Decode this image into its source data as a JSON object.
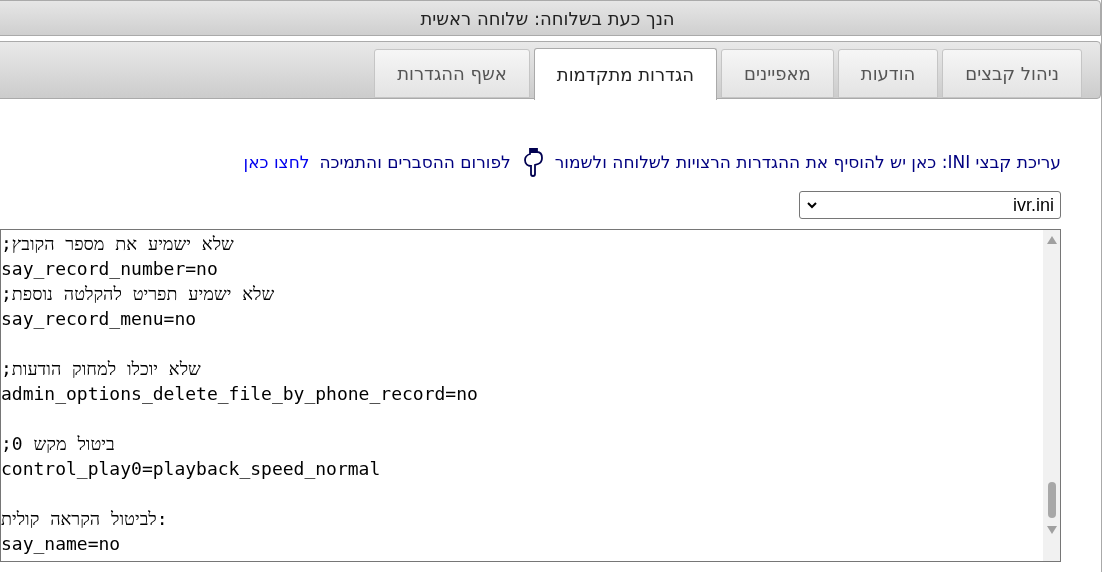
{
  "header": {
    "title": "הנך כעת בשלוחה: שלוחה ראשית"
  },
  "tabs": [
    {
      "label": "ניהול קבצים",
      "selected": false
    },
    {
      "label": "הודעות",
      "selected": false
    },
    {
      "label": "מאפיינים",
      "selected": false
    },
    {
      "label": "הגדרות מתקדמות",
      "selected": true
    },
    {
      "label": "אשף ההגדרות",
      "selected": false
    }
  ],
  "info": {
    "text": "עריכת קבצי INI: כאן יש להוסיף את ההגדרות הרצויות לשלוחה ולשמור",
    "forum_text": "לפורום ההסברים והתמיכה",
    "link": "לחצו כאן"
  },
  "file_select": {
    "value": "ivr.ini"
  },
  "editor": {
    "lines": [
      {
        "kind": "text",
        "text": ";שלא ישמיע את מספר הקובץ"
      },
      {
        "kind": "text",
        "text": "say_record_number=no"
      },
      {
        "kind": "text",
        "text": ";שלא ישמיע תפריט להקלטה נוספת"
      },
      {
        "kind": "text",
        "text": "say_record_menu=no"
      },
      {
        "kind": "blank"
      },
      {
        "kind": "text",
        "text": ";שלא יוכלו למחוק הודעות"
      },
      {
        "kind": "text",
        "text": "admin_options_delete_file_by_phone_record=no"
      },
      {
        "kind": "blank"
      },
      {
        "kind": "text",
        "text": ";ביטול מקש 0"
      },
      {
        "kind": "text",
        "text": "control_play0=playback_speed_normal"
      },
      {
        "kind": "blank"
      },
      {
        "kind": "text",
        "text": "לביטול הקראה קולית:"
      },
      {
        "kind": "text",
        "text": "say_name=no"
      }
    ]
  }
}
